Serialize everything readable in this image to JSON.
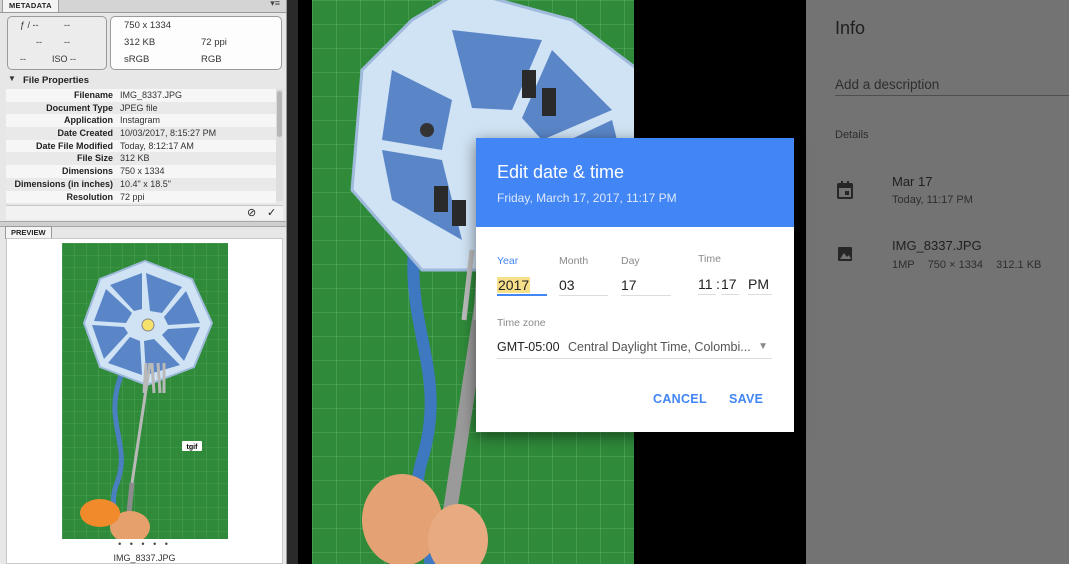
{
  "metadata_panel": {
    "tab_label": "METADATA",
    "camera": {
      "aperture": "ƒ / --",
      "shutter": "--",
      "exposure": "--",
      "focal": "--",
      "flash": "--",
      "iso": "ISO --"
    },
    "image_info": {
      "dimensions": "750 x 1334",
      "size": "312 KB",
      "resolution": "72 ppi",
      "color_space": "sRGB",
      "color_model": "RGB"
    },
    "file_properties_title": "File Properties",
    "properties": [
      {
        "key": "Filename",
        "value": "IMG_8337.JPG"
      },
      {
        "key": "Document Type",
        "value": "JPEG file"
      },
      {
        "key": "Application",
        "value": "Instagram"
      },
      {
        "key": "Date Created",
        "value": "10/03/2017, 8:15:27 PM"
      },
      {
        "key": "Date File Modified",
        "value": "Today, 8:12:17 AM"
      },
      {
        "key": "File Size",
        "value": "312 KB"
      },
      {
        "key": "Dimensions",
        "value": "750 x 1334"
      },
      {
        "key": "Dimensions (in inches)",
        "value": "10.4\" x 18.5\""
      },
      {
        "key": "Resolution",
        "value": "72 ppi"
      }
    ],
    "preview_tab_label": "PREVIEW",
    "preview_dots": "• • • • •",
    "preview_filename": "IMG_8337.JPG",
    "preview_sticker": "tgif"
  },
  "info_panel": {
    "title": "Info",
    "description_placeholder": "Add a description",
    "details_label": "Details",
    "date_main": "Mar 17",
    "date_sub": "Today, 11:17 PM",
    "file_name": "IMG_8337.JPG",
    "file_meta": [
      "1MP",
      "750 × 1334",
      "312.1 KB"
    ]
  },
  "dialog": {
    "title": "Edit date & time",
    "subtitle": "Friday, March 17, 2017, 11:17 PM",
    "labels": {
      "year": "Year",
      "month": "Month",
      "day": "Day",
      "time": "Time",
      "timezone": "Time zone"
    },
    "values": {
      "year": "2017",
      "month": "03",
      "day": "17",
      "hour": "11",
      "minute": "17",
      "ampm": "PM"
    },
    "time_separator": ":",
    "timezone_offset": "GMT-05:00",
    "timezone_name": "Central Daylight Time, Colombi...",
    "cancel_label": "CANCEL",
    "save_label": "SAVE"
  },
  "colors": {
    "accent": "#4285f4",
    "info_panel_bg": "#737373",
    "metadata_bg": "#e7e7e7",
    "mat_green": "#2f8a3a",
    "socket_blue": "#5a86c8"
  }
}
